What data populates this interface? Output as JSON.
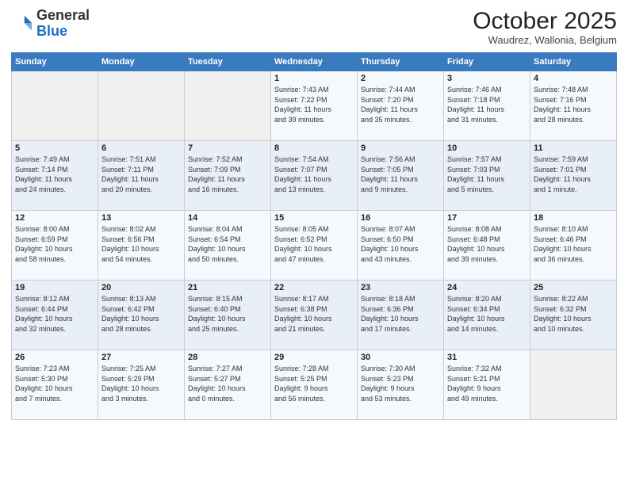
{
  "header": {
    "logo_line1": "General",
    "logo_line2": "Blue",
    "month": "October 2025",
    "location": "Waudrez, Wallonia, Belgium"
  },
  "weekdays": [
    "Sunday",
    "Monday",
    "Tuesday",
    "Wednesday",
    "Thursday",
    "Friday",
    "Saturday"
  ],
  "weeks": [
    [
      {
        "day": "",
        "info": ""
      },
      {
        "day": "",
        "info": ""
      },
      {
        "day": "",
        "info": ""
      },
      {
        "day": "1",
        "info": "Sunrise: 7:43 AM\nSunset: 7:22 PM\nDaylight: 11 hours\nand 39 minutes."
      },
      {
        "day": "2",
        "info": "Sunrise: 7:44 AM\nSunset: 7:20 PM\nDaylight: 11 hours\nand 35 minutes."
      },
      {
        "day": "3",
        "info": "Sunrise: 7:46 AM\nSunset: 7:18 PM\nDaylight: 11 hours\nand 31 minutes."
      },
      {
        "day": "4",
        "info": "Sunrise: 7:48 AM\nSunset: 7:16 PM\nDaylight: 11 hours\nand 28 minutes."
      }
    ],
    [
      {
        "day": "5",
        "info": "Sunrise: 7:49 AM\nSunset: 7:14 PM\nDaylight: 11 hours\nand 24 minutes."
      },
      {
        "day": "6",
        "info": "Sunrise: 7:51 AM\nSunset: 7:11 PM\nDaylight: 11 hours\nand 20 minutes."
      },
      {
        "day": "7",
        "info": "Sunrise: 7:52 AM\nSunset: 7:09 PM\nDaylight: 11 hours\nand 16 minutes."
      },
      {
        "day": "8",
        "info": "Sunrise: 7:54 AM\nSunset: 7:07 PM\nDaylight: 11 hours\nand 13 minutes."
      },
      {
        "day": "9",
        "info": "Sunrise: 7:56 AM\nSunset: 7:05 PM\nDaylight: 11 hours\nand 9 minutes."
      },
      {
        "day": "10",
        "info": "Sunrise: 7:57 AM\nSunset: 7:03 PM\nDaylight: 11 hours\nand 5 minutes."
      },
      {
        "day": "11",
        "info": "Sunrise: 7:59 AM\nSunset: 7:01 PM\nDaylight: 11 hours\nand 1 minute."
      }
    ],
    [
      {
        "day": "12",
        "info": "Sunrise: 8:00 AM\nSunset: 6:59 PM\nDaylight: 10 hours\nand 58 minutes."
      },
      {
        "day": "13",
        "info": "Sunrise: 8:02 AM\nSunset: 6:56 PM\nDaylight: 10 hours\nand 54 minutes."
      },
      {
        "day": "14",
        "info": "Sunrise: 8:04 AM\nSunset: 6:54 PM\nDaylight: 10 hours\nand 50 minutes."
      },
      {
        "day": "15",
        "info": "Sunrise: 8:05 AM\nSunset: 6:52 PM\nDaylight: 10 hours\nand 47 minutes."
      },
      {
        "day": "16",
        "info": "Sunrise: 8:07 AM\nSunset: 6:50 PM\nDaylight: 10 hours\nand 43 minutes."
      },
      {
        "day": "17",
        "info": "Sunrise: 8:08 AM\nSunset: 6:48 PM\nDaylight: 10 hours\nand 39 minutes."
      },
      {
        "day": "18",
        "info": "Sunrise: 8:10 AM\nSunset: 6:46 PM\nDaylight: 10 hours\nand 36 minutes."
      }
    ],
    [
      {
        "day": "19",
        "info": "Sunrise: 8:12 AM\nSunset: 6:44 PM\nDaylight: 10 hours\nand 32 minutes."
      },
      {
        "day": "20",
        "info": "Sunrise: 8:13 AM\nSunset: 6:42 PM\nDaylight: 10 hours\nand 28 minutes."
      },
      {
        "day": "21",
        "info": "Sunrise: 8:15 AM\nSunset: 6:40 PM\nDaylight: 10 hours\nand 25 minutes."
      },
      {
        "day": "22",
        "info": "Sunrise: 8:17 AM\nSunset: 6:38 PM\nDaylight: 10 hours\nand 21 minutes."
      },
      {
        "day": "23",
        "info": "Sunrise: 8:18 AM\nSunset: 6:36 PM\nDaylight: 10 hours\nand 17 minutes."
      },
      {
        "day": "24",
        "info": "Sunrise: 8:20 AM\nSunset: 6:34 PM\nDaylight: 10 hours\nand 14 minutes."
      },
      {
        "day": "25",
        "info": "Sunrise: 8:22 AM\nSunset: 6:32 PM\nDaylight: 10 hours\nand 10 minutes."
      }
    ],
    [
      {
        "day": "26",
        "info": "Sunrise: 7:23 AM\nSunset: 5:30 PM\nDaylight: 10 hours\nand 7 minutes."
      },
      {
        "day": "27",
        "info": "Sunrise: 7:25 AM\nSunset: 5:29 PM\nDaylight: 10 hours\nand 3 minutes."
      },
      {
        "day": "28",
        "info": "Sunrise: 7:27 AM\nSunset: 5:27 PM\nDaylight: 10 hours\nand 0 minutes."
      },
      {
        "day": "29",
        "info": "Sunrise: 7:28 AM\nSunset: 5:25 PM\nDaylight: 9 hours\nand 56 minutes."
      },
      {
        "day": "30",
        "info": "Sunrise: 7:30 AM\nSunset: 5:23 PM\nDaylight: 9 hours\nand 53 minutes."
      },
      {
        "day": "31",
        "info": "Sunrise: 7:32 AM\nSunset: 5:21 PM\nDaylight: 9 hours\nand 49 minutes."
      },
      {
        "day": "",
        "info": ""
      }
    ]
  ]
}
